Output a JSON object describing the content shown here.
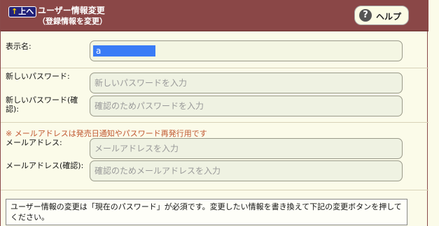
{
  "header": {
    "up_label": "上へ",
    "up_arrow": "↑",
    "title": "ユーザー情報変更",
    "subtitle": "（登録情報を変更）",
    "help_label": "ヘルプ",
    "help_icon": "?"
  },
  "form": {
    "display_name": {
      "label": "表示名:",
      "value": "a"
    },
    "new_password": {
      "label": "新しいパスワード:",
      "placeholder": "新しいパスワードを入力"
    },
    "new_password_confirm": {
      "label": "新しいパスワード(確認):",
      "placeholder": "確認のためパスワードを入力"
    },
    "note": "※ メールアドレスは発売日通知やパスワード再発行用です",
    "email": {
      "label": "メールアドレス:",
      "placeholder": "メールアドレスを入力"
    },
    "email_confirm": {
      "label": "メールアドレス(確認):",
      "placeholder": "確認のためメールアドレスを入力"
    }
  },
  "info_text": "ユーザー情報の変更は「現在のパスワード」が必須です。変更したい情報を書き換えて下記の変更ボタンを押してください。",
  "colors": {
    "header_bg": "#8a4747",
    "page_bg": "#fbfbe9",
    "note_color": "#c0562f",
    "selection": "#3a7cf6"
  }
}
